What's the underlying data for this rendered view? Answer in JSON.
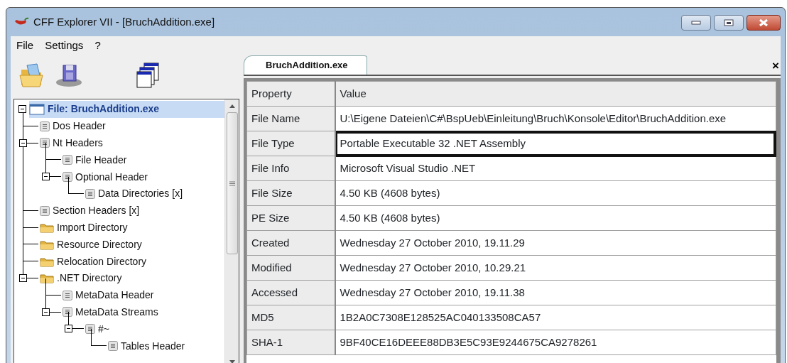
{
  "window": {
    "title": "CFF Explorer VII - [BruchAddition.exe]"
  },
  "menu": [
    "File",
    "Settings",
    "?"
  ],
  "tree": [
    {
      "label": "File: BruchAddition.exe",
      "kind": "file",
      "selected": true,
      "expanded": true,
      "children": [
        {
          "label": "Dos Header",
          "kind": "doc",
          "selected": false
        },
        {
          "label": "Nt Headers",
          "kind": "doc",
          "selected": false,
          "expanded": true,
          "children": [
            {
              "label": "File Header",
              "kind": "doc",
              "selected": false
            },
            {
              "label": "Optional Header",
              "kind": "doc",
              "selected": false,
              "expanded": true,
              "children": [
                {
                  "label": "Data Directories [x]",
                  "kind": "doc",
                  "selected": false
                }
              ]
            }
          ]
        },
        {
          "label": "Section Headers [x]",
          "kind": "doc",
          "selected": false
        },
        {
          "label": "Import Directory",
          "kind": "folder",
          "selected": false
        },
        {
          "label": "Resource Directory",
          "kind": "folder",
          "selected": false
        },
        {
          "label": "Relocation Directory",
          "kind": "folder",
          "selected": false
        },
        {
          "label": ".NET Directory",
          "kind": "folder",
          "selected": false,
          "expanded": true,
          "children": [
            {
              "label": "MetaData Header",
              "kind": "doc",
              "selected": false
            },
            {
              "label": "MetaData Streams",
              "kind": "doc",
              "selected": false,
              "expanded": true,
              "children": [
                {
                  "label": "#~",
                  "kind": "doc",
                  "selected": false,
                  "expanded": true,
                  "children": [
                    {
                      "label": "Tables Header",
                      "kind": "doc",
                      "selected": false
                    }
                  ]
                }
              ]
            }
          ]
        }
      ]
    }
  ],
  "tabs": [
    {
      "label": "BruchAddition.exe",
      "selected": true
    }
  ],
  "tab_close": "×",
  "table": {
    "columns": [
      "Property",
      "Value"
    ],
    "rows": [
      {
        "property": "File Name",
        "value": "U:\\Eigene Dateien\\C#\\BspUeb\\Einleitung\\Bruch\\Konsole\\Editor\\BruchAddition.exe",
        "selected": false
      },
      {
        "property": "File Type",
        "value": "Portable Executable 32 .NET Assembly",
        "selected": true
      },
      {
        "property": "File Info",
        "value": "Microsoft Visual Studio .NET",
        "selected": false
      },
      {
        "property": "File Size",
        "value": "4.50 KB (4608 bytes)",
        "selected": false
      },
      {
        "property": "PE Size",
        "value": "4.50 KB (4608 bytes)",
        "selected": false
      },
      {
        "property": "Created",
        "value": "Wednesday 27 October 2010, 19.11.29",
        "selected": false
      },
      {
        "property": "Modified",
        "value": "Wednesday 27 October 2010, 10.29.21",
        "selected": false
      },
      {
        "property": "Accessed",
        "value": "Wednesday 27 October 2010, 19.11.38",
        "selected": false
      },
      {
        "property": "MD5",
        "value": "1B2A0C7308E128525AC040133508CA57",
        "selected": false
      },
      {
        "property": "SHA-1",
        "value": "9BF40CE16DEEE88DB3E5C93E9244675CA9278261",
        "selected": false
      }
    ]
  }
}
